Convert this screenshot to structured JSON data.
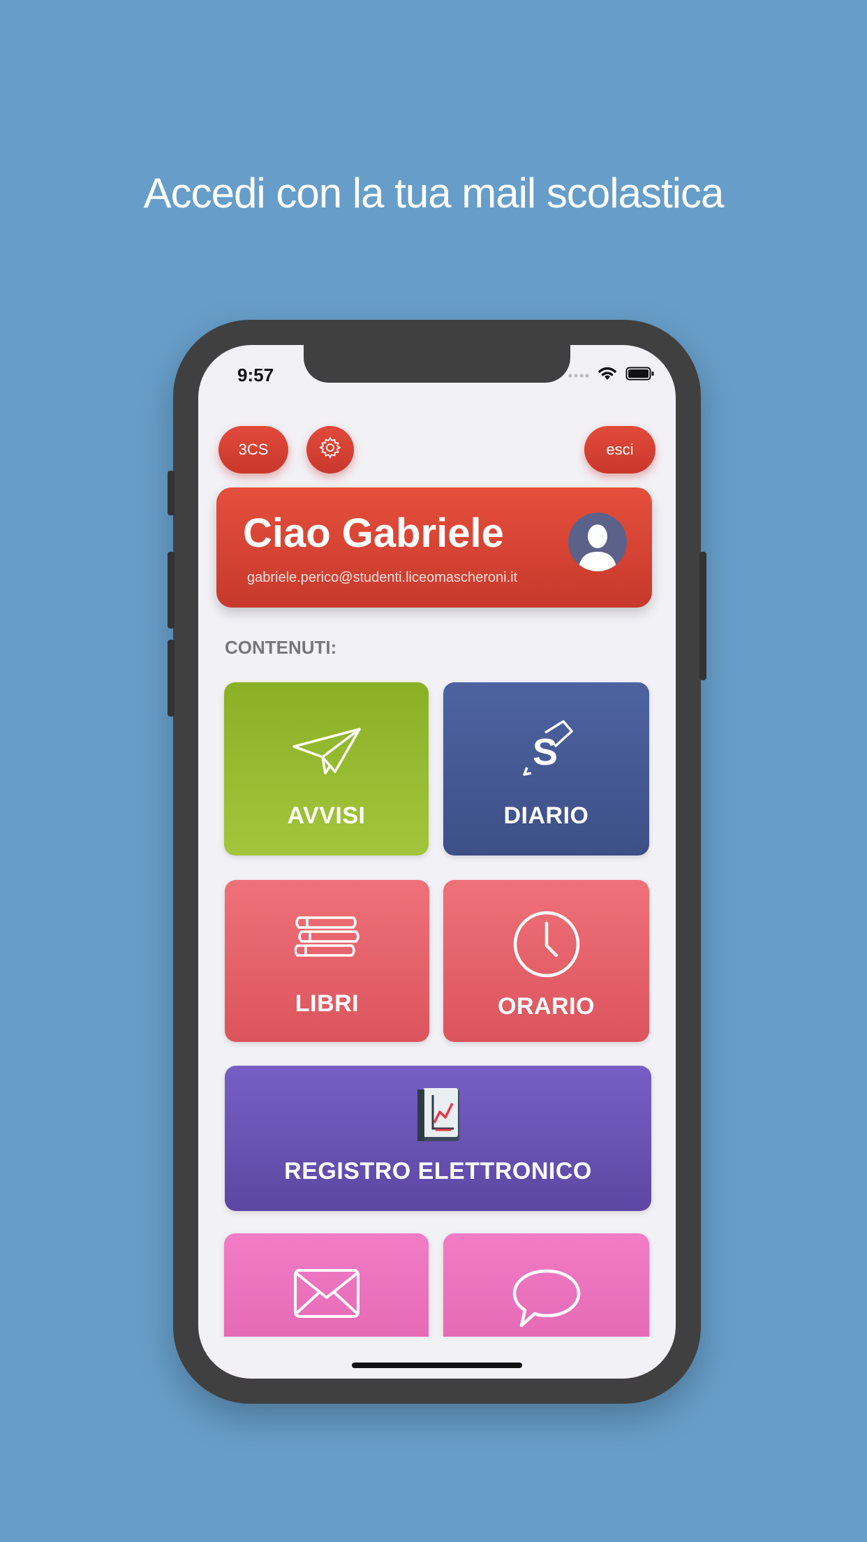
{
  "headline": "Accedi con la tua mail scolastica",
  "status": {
    "time": "9:57"
  },
  "top_bar": {
    "class_label": "3CS",
    "logout_label": "esci"
  },
  "greeting": {
    "title": "Ciao Gabriele",
    "email": "gabriele.perico@studenti.liceomascheroni.it"
  },
  "section_label": "CONTENUTI:",
  "tiles": {
    "avvisi": "AVVISI",
    "diario": "DIARIO",
    "libri": "LIBRI",
    "orario": "ORARIO",
    "registro": "REGISTRO ELETTRONICO"
  },
  "icons": [
    "paper-plane-icon",
    "pen-s-icon",
    "books-icon",
    "clock-icon",
    "ledger-icon",
    "mail-icon",
    "chat-icon",
    "gear-icon",
    "avatar-icon"
  ],
  "colors": {
    "background": "#679ec9",
    "accent_red": "#e24b3b",
    "avvisi": "#8ab026",
    "diario": "#4d63a1",
    "libri": "#e8646d",
    "registro": "#6d57b9",
    "messages": "#ef76c1"
  }
}
